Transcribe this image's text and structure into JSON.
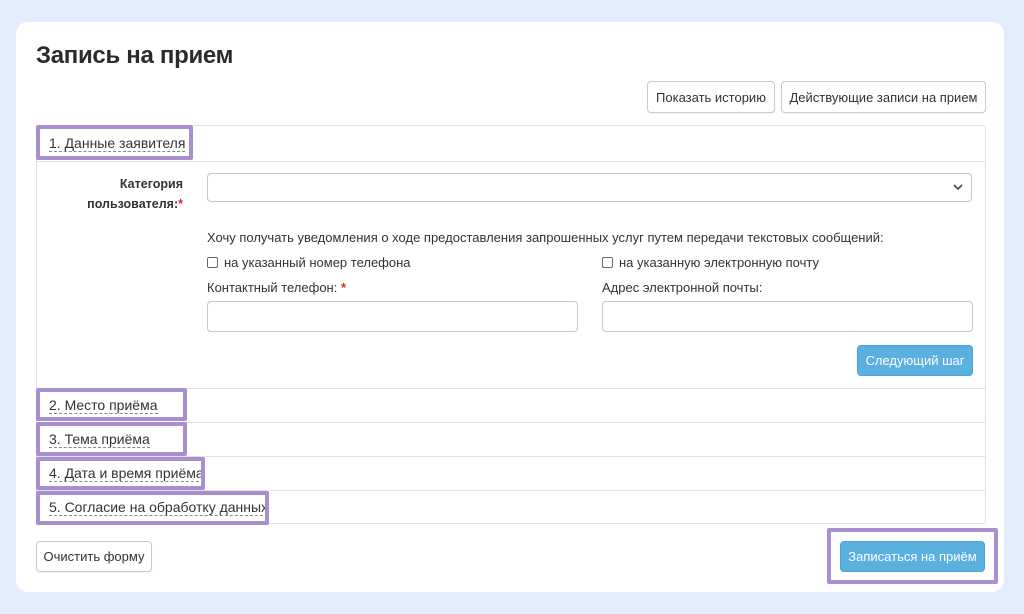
{
  "page": {
    "title": "Запись на прием"
  },
  "toolbar": {
    "history_label": "Показать историю",
    "active_label": "Действующие записи на прием"
  },
  "sections": [
    {
      "label": "1. Данные заявителя",
      "expanded": true
    },
    {
      "label": "2. Место приёма",
      "expanded": false
    },
    {
      "label": "3. Тема приёма",
      "expanded": false
    },
    {
      "label": "4. Дата и время приёма",
      "expanded": false
    },
    {
      "label": "5. Согласие на обработку данных",
      "expanded": false
    }
  ],
  "form": {
    "category_label_line1": "Категория",
    "category_label_line2": "пользователя:",
    "required_mark": "*",
    "category_value": "",
    "notify_text": "Хочу получать уведомления о ходе предоставления запрошенных услуг путем передачи текстовых сообщений:",
    "notify_phone_label": "на указанный номер телефона",
    "notify_phone_checked": false,
    "notify_email_label": "на указанную электронную почту",
    "notify_email_checked": false,
    "phone_label": "Контактный телефон:",
    "phone_value": "",
    "email_label": "Адрес электронной почты:",
    "email_value": "",
    "next_label": "Следующий шаг"
  },
  "footer": {
    "clear_label": "Очистить форму",
    "submit_label": "Записаться на приём"
  },
  "colors": {
    "background": "#e3ecfb",
    "primary": "#5ab0de",
    "highlight": "#a98fd0",
    "required": "#d9262c"
  },
  "icons": {
    "select_arrow": "chevron-down-icon"
  }
}
